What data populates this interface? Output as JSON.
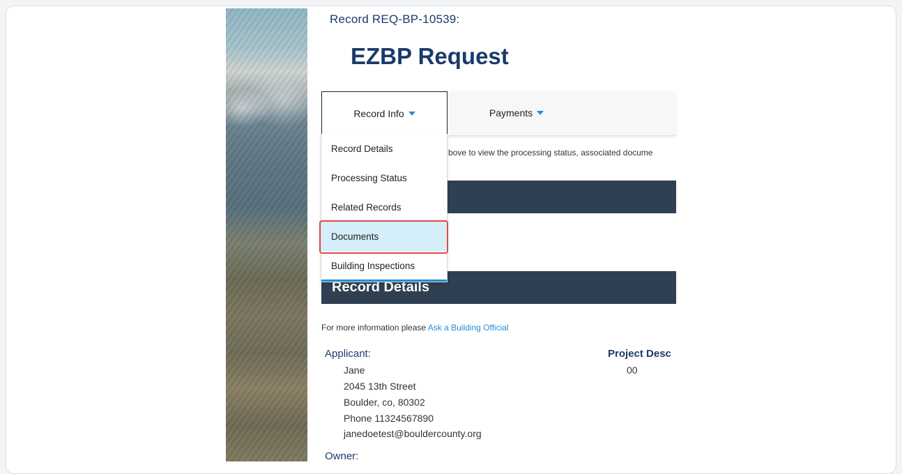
{
  "record": {
    "id_line": "Record REQ-BP-10539:",
    "title": "EZBP Request"
  },
  "tabs": [
    {
      "label": "Record Info",
      "icon": "caret-down-icon"
    },
    {
      "label": "Payments",
      "icon": "caret-down-icon"
    }
  ],
  "dropdown": {
    "items": [
      {
        "label": "Record Details"
      },
      {
        "label": "Processing Status"
      },
      {
        "label": "Related Records"
      },
      {
        "label": "Documents",
        "highlighted": true
      },
      {
        "label": "Building Inspections"
      }
    ]
  },
  "hint_text": "bove to view the processing status, associated docume",
  "section": {
    "record_details_title": "Record Details"
  },
  "info": {
    "prefix": "For more information please ",
    "link": "Ask a Building Official"
  },
  "applicant": {
    "label": "Applicant:",
    "name": "Jane",
    "street": "2045 13th Street",
    "city": "Boulder, co, 80302",
    "phone": "Phone 11324567890",
    "email": "janedoetest@bouldercounty.org"
  },
  "project": {
    "label": "Project Desc",
    "value": "00"
  },
  "owner": {
    "label": "Owner:"
  },
  "colors": {
    "title_navy": "#1b3a6b",
    "section_bar": "#2e4051",
    "accent_blue": "#1e8fd6",
    "highlight_red": "#e04848",
    "selected_item_bg": "#d4eefa"
  }
}
